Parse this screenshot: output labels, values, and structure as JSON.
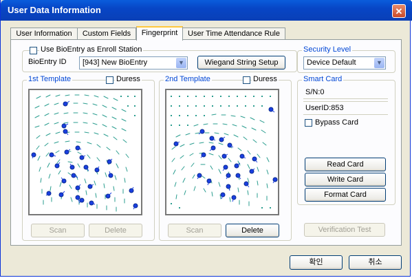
{
  "window": {
    "title": "User Data Information",
    "close_glyph": "✕"
  },
  "tabs": [
    {
      "label": "User Information",
      "active": false
    },
    {
      "label": "Custom Fields",
      "active": false
    },
    {
      "label": "Fingerprint",
      "active": true
    },
    {
      "label": "User Time Attendance Rule",
      "active": false
    }
  ],
  "enroll": {
    "use_bioentry_label": "Use BioEntry as Enroll Station",
    "use_bioentry_checked": false,
    "bioentry_id_label": "BioEntry ID",
    "bioentry_id_value": "[943] New BioEntry",
    "wiegand_button": "Wiegand String Setup"
  },
  "template1": {
    "title": "1st Template",
    "duress_label": "Duress",
    "duress_checked": false,
    "scan_button": "Scan",
    "delete_button": "Delete",
    "scan_enabled": false,
    "delete_enabled": false
  },
  "template2": {
    "title": "2nd Template",
    "duress_label": "Duress",
    "duress_checked": false,
    "scan_button": "Scan",
    "delete_button": "Delete",
    "scan_enabled": false,
    "delete_enabled": true
  },
  "security": {
    "title": "Security Level",
    "value": "Device Default"
  },
  "smart_card": {
    "title": "Smart Card",
    "serial": "S/N:0",
    "userid": "UserID:853",
    "bypass_label": "Bypass Card",
    "bypass_checked": false,
    "read_button": "Read Card",
    "write_button": "Write Card",
    "format_button": "Format Card",
    "verification_button": "Verification Test"
  },
  "footer": {
    "ok_button": "확인",
    "cancel_button": "취소"
  },
  "colors": {
    "titlebar": "#0a4fd1",
    "group_label": "#0046d5",
    "ridge": "#2a9d8f",
    "minutia": "#1a3fe0"
  },
  "icons": {
    "close": "close-icon",
    "dropdown": "chevron-down-icon"
  }
}
